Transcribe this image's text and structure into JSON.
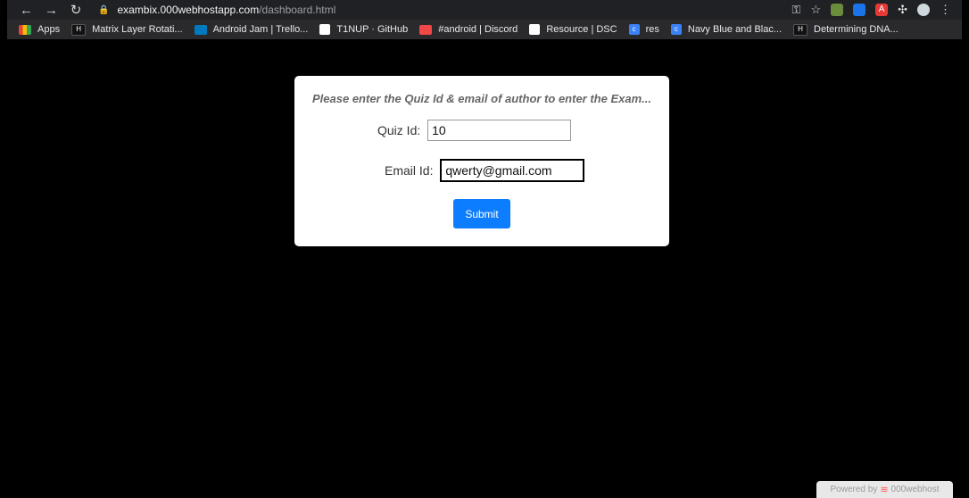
{
  "browser": {
    "url_host": "exambix.000webhostapp.com",
    "url_path": "/dashboard.html",
    "bookmarks": [
      {
        "label": "Apps",
        "icon": "apps-grid-icon"
      },
      {
        "label": "Matrix Layer Rotati...",
        "icon": "hackerrank-icon"
      },
      {
        "label": "Android Jam | Trello...",
        "icon": "trello-icon"
      },
      {
        "label": "T1NUP · GitHub",
        "icon": "github-icon"
      },
      {
        "label": "#android | Discord",
        "icon": "discord-icon"
      },
      {
        "label": "Resource | DSC",
        "icon": "github-icon"
      },
      {
        "label": "res",
        "icon": "chrome-c-icon"
      },
      {
        "label": "Navy Blue and Blac...",
        "icon": "chrome-c-icon"
      },
      {
        "label": "Determining DNA...",
        "icon": "hackerrank-icon"
      }
    ]
  },
  "card": {
    "title": "Please enter the Quiz Id & email of author to enter the Exam...",
    "quiz_label": "Quiz Id:",
    "quiz_value": "10",
    "email_label": "Email Id:",
    "email_value": "qwerty@gmail.com",
    "submit_label": "Submit"
  },
  "footer": {
    "powered_label": "Powered by",
    "host_brand": "000webhost"
  },
  "colors": {
    "background": "#000000",
    "card": "#ffffff",
    "submit": "#0d7dff"
  }
}
